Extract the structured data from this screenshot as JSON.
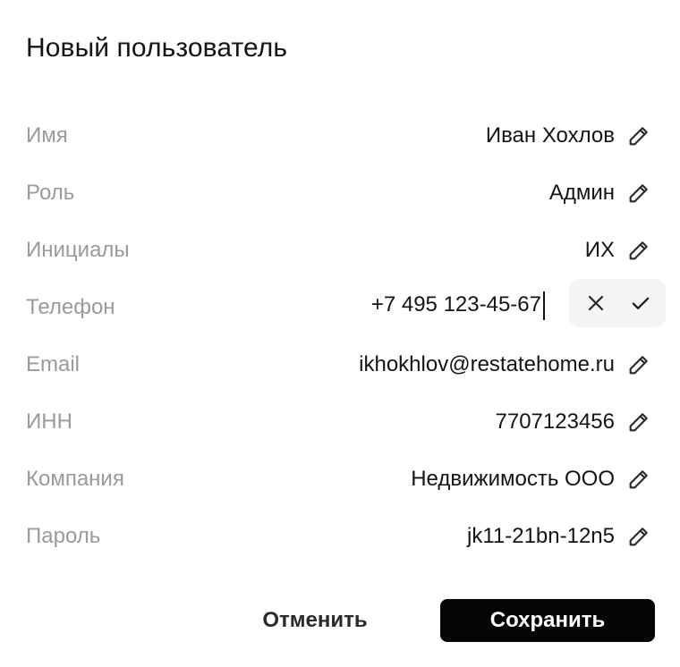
{
  "dialog": {
    "title": "Новый пользователь"
  },
  "fields": [
    {
      "label": "Имя",
      "value": "Иван Хохлов"
    },
    {
      "label": "Роль",
      "value": "Админ"
    },
    {
      "label": "Инициалы",
      "value": "ИХ"
    },
    {
      "label": "Телефон",
      "value": "+7 495 123-45-67"
    },
    {
      "label": "Email",
      "value": "ikhokhlov@restatehome.ru"
    },
    {
      "label": "ИНН",
      "value": "7707123456"
    },
    {
      "label": "Компания",
      "value": "Недвижимость ООО"
    },
    {
      "label": "Пароль",
      "value": "jk11-21bn-12n5"
    }
  ],
  "editing": {
    "field_label": "Телефон",
    "icons": {
      "cancel": "close-icon",
      "confirm": "check-icon"
    }
  },
  "icons": {
    "edit": "pencil-icon"
  },
  "footer": {
    "cancel_label": "Отменить",
    "save_label": "Сохранить"
  },
  "colors": {
    "label": "#9a9a9a",
    "value": "#141414",
    "primary_button": "#050505",
    "action_pill": "#f4f4f4"
  }
}
